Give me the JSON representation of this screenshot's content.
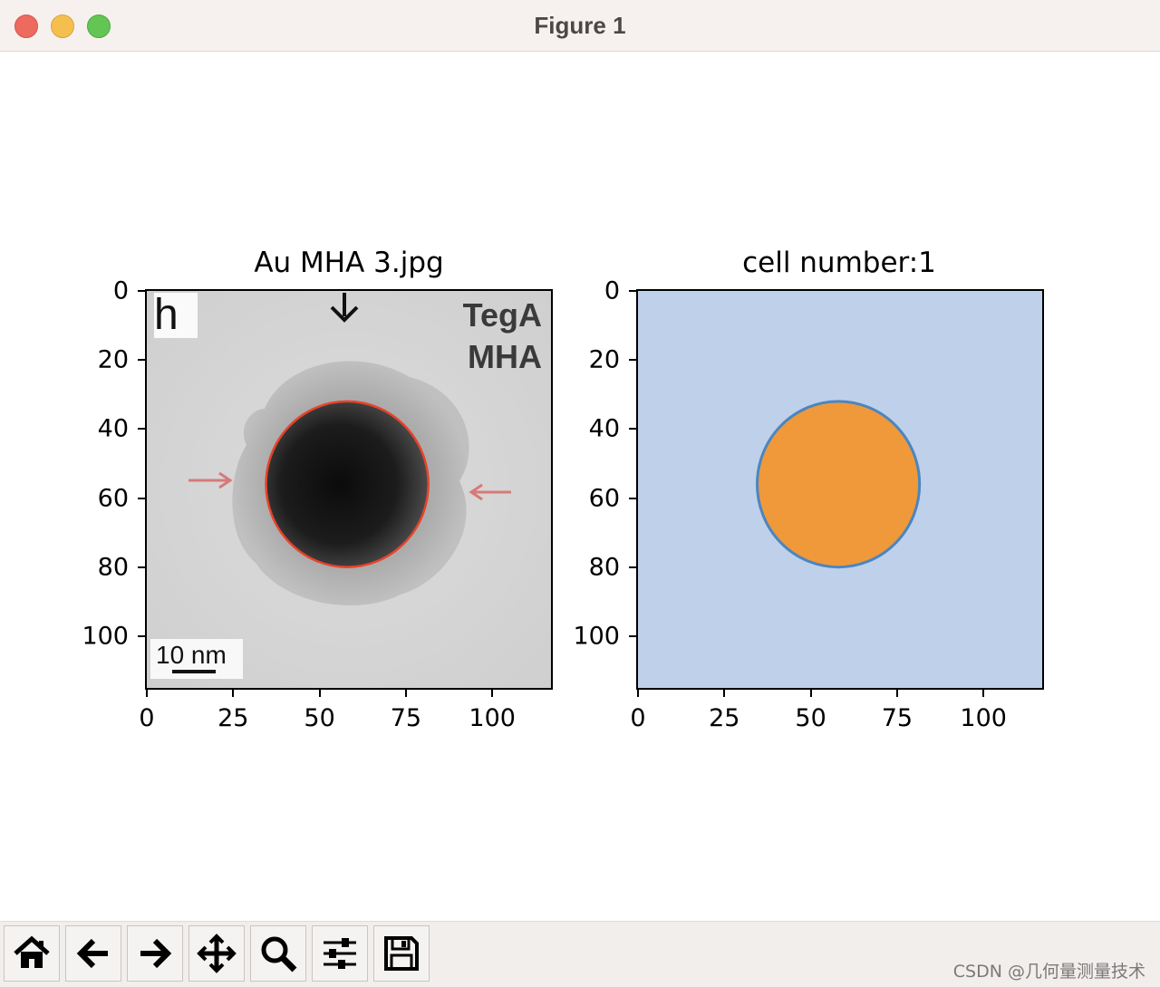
{
  "window": {
    "title": "Figure 1",
    "buttons": [
      "close",
      "minimize",
      "maximize"
    ]
  },
  "figure": {
    "left_axes": {
      "title": "Au MHA 3.jpg",
      "image_text": {
        "panel_letter": "h",
        "label_line1": "TegA",
        "label_line2": "MHA",
        "scale_bar": "10 nm"
      },
      "contour_color": "#e8432a"
    },
    "right_axes": {
      "title": "cell number:1",
      "background_color": "#bfd0ea",
      "region_color": "#f0993a",
      "region_edge_color": "#4a86c0"
    }
  },
  "chart_data": [
    {
      "type": "image",
      "title": "Au MHA 3.jpg",
      "xticks": [
        "0",
        "25",
        "50",
        "75",
        "100"
      ],
      "yticks": [
        "0",
        "20",
        "40",
        "60",
        "80",
        "100"
      ],
      "xlim": [
        0,
        117
      ],
      "ylim": [
        115,
        0
      ],
      "contour": {
        "center": [
          58,
          56
        ],
        "radius_x": 23.5,
        "radius_y": 24,
        "color": "#e8432a"
      }
    },
    {
      "type": "image",
      "title": "cell number:1",
      "xticks": [
        "0",
        "25",
        "50",
        "75",
        "100"
      ],
      "yticks": [
        "0",
        "20",
        "40",
        "60",
        "80",
        "100"
      ],
      "xlim": [
        0,
        117
      ],
      "ylim": [
        115,
        0
      ],
      "region": {
        "center": [
          58,
          56
        ],
        "radius_x": 23.5,
        "radius_y": 24,
        "fill": "#f0993a",
        "edge": "#4a86c0"
      }
    }
  ],
  "toolbar": {
    "buttons": [
      {
        "name": "home",
        "icon": "home-icon"
      },
      {
        "name": "back",
        "icon": "arrow-left-icon"
      },
      {
        "name": "forward",
        "icon": "arrow-right-icon"
      },
      {
        "name": "pan",
        "icon": "move-icon"
      },
      {
        "name": "zoom",
        "icon": "magnifier-icon"
      },
      {
        "name": "configure-subplots",
        "icon": "sliders-icon"
      },
      {
        "name": "save",
        "icon": "floppy-disk-icon"
      }
    ]
  },
  "watermark": "CSDN @几何量测量技术"
}
